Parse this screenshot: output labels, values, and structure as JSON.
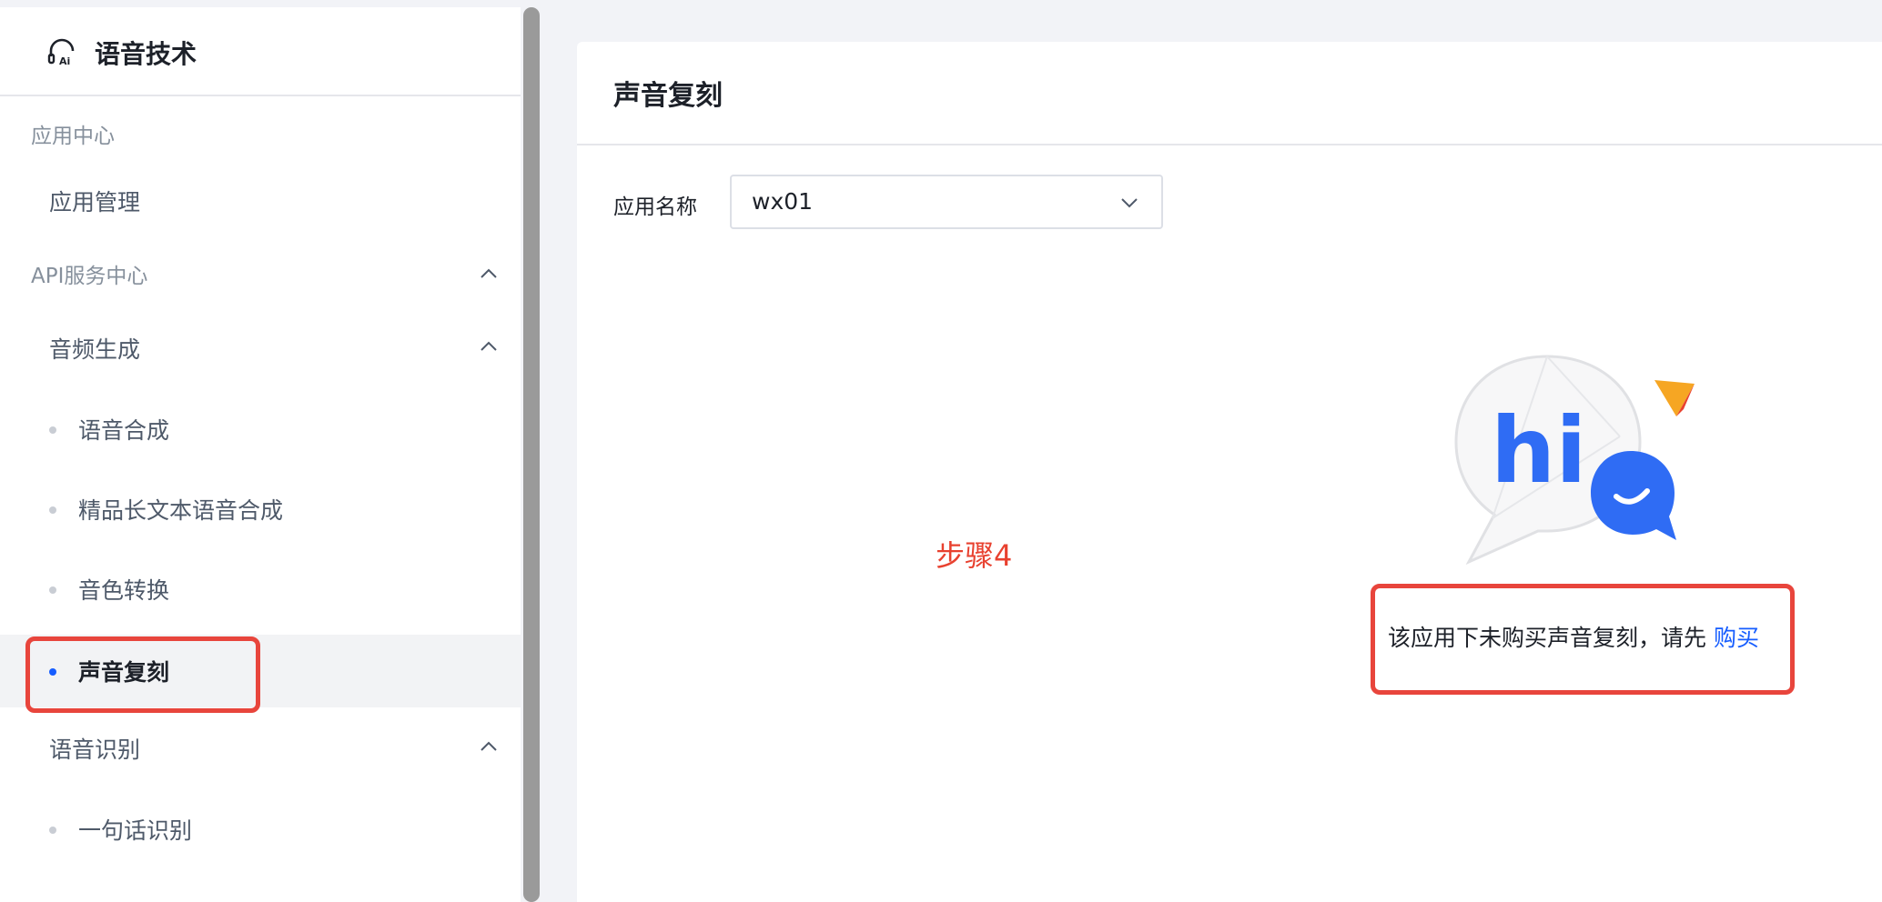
{
  "sidebar": {
    "brand_icon": "headset-ai-icon",
    "brand_title": "语音技术",
    "groups": [
      {
        "title": "应用中心"
      },
      {
        "title": "API服务中心"
      }
    ],
    "app_manage_label": "应用管理",
    "audio_gen_label": "音频生成",
    "audio_gen_items": [
      {
        "label": "语音合成"
      },
      {
        "label": "精品长文本语音合成"
      },
      {
        "label": "音色转换"
      },
      {
        "label": "声音复刻"
      }
    ],
    "speech_rec_label": "语音识别",
    "speech_rec_items": [
      {
        "label": "一句话识别"
      }
    ]
  },
  "main": {
    "page_title": "声音复刻",
    "app_name_label": "应用名称",
    "app_name_value": "wx01",
    "step_label": "步骤4",
    "empty_text": "该应用下未购买声音复刻，请先",
    "buy_link": "购买",
    "illustration_text": "hi"
  },
  "colors": {
    "accent": "#165dff",
    "highlight": "#e8453c",
    "step_text": "#e8412f"
  }
}
